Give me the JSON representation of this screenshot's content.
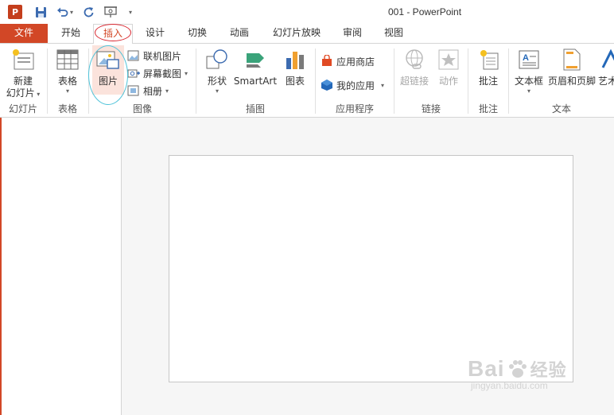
{
  "window": {
    "title": "001 - PowerPoint",
    "app_logo": "P"
  },
  "tabs": [
    {
      "label": "文件"
    },
    {
      "label": "开始"
    },
    {
      "label": "插入"
    },
    {
      "label": "设计"
    },
    {
      "label": "切换"
    },
    {
      "label": "动画"
    },
    {
      "label": "幻灯片放映"
    },
    {
      "label": "审阅"
    },
    {
      "label": "视图"
    }
  ],
  "ribbon": {
    "slides": {
      "label": "幻灯片",
      "new_slide_line1": "新建",
      "new_slide_line2": "幻灯片"
    },
    "tables": {
      "label": "表格",
      "table": "表格"
    },
    "images": {
      "label": "图像",
      "picture": "图片",
      "online_pictures": "联机图片",
      "screenshot": "屏幕截图",
      "photo_album": "相册"
    },
    "illustrations": {
      "label": "插图",
      "shapes": "形状",
      "smartart": "SmartArt",
      "chart": "图表"
    },
    "apps": {
      "label": "应用程序",
      "store": "应用商店",
      "my_apps": "我的应用"
    },
    "links": {
      "label": "链接",
      "hyperlink": "超链接",
      "action": "动作"
    },
    "comments": {
      "label": "批注",
      "comment": "批注"
    },
    "text": {
      "label": "文本",
      "text_box": "文本框",
      "header_footer": "页眉和页脚",
      "wordart": "艺术"
    }
  },
  "watermark": {
    "main": "Bai",
    "main_tail": "经验",
    "sub": "jingyan.baidu.com"
  },
  "colors": {
    "accent": "#d24726",
    "annotation_red": "#d9262f",
    "annotation_cyan": "#4fc3d9"
  }
}
